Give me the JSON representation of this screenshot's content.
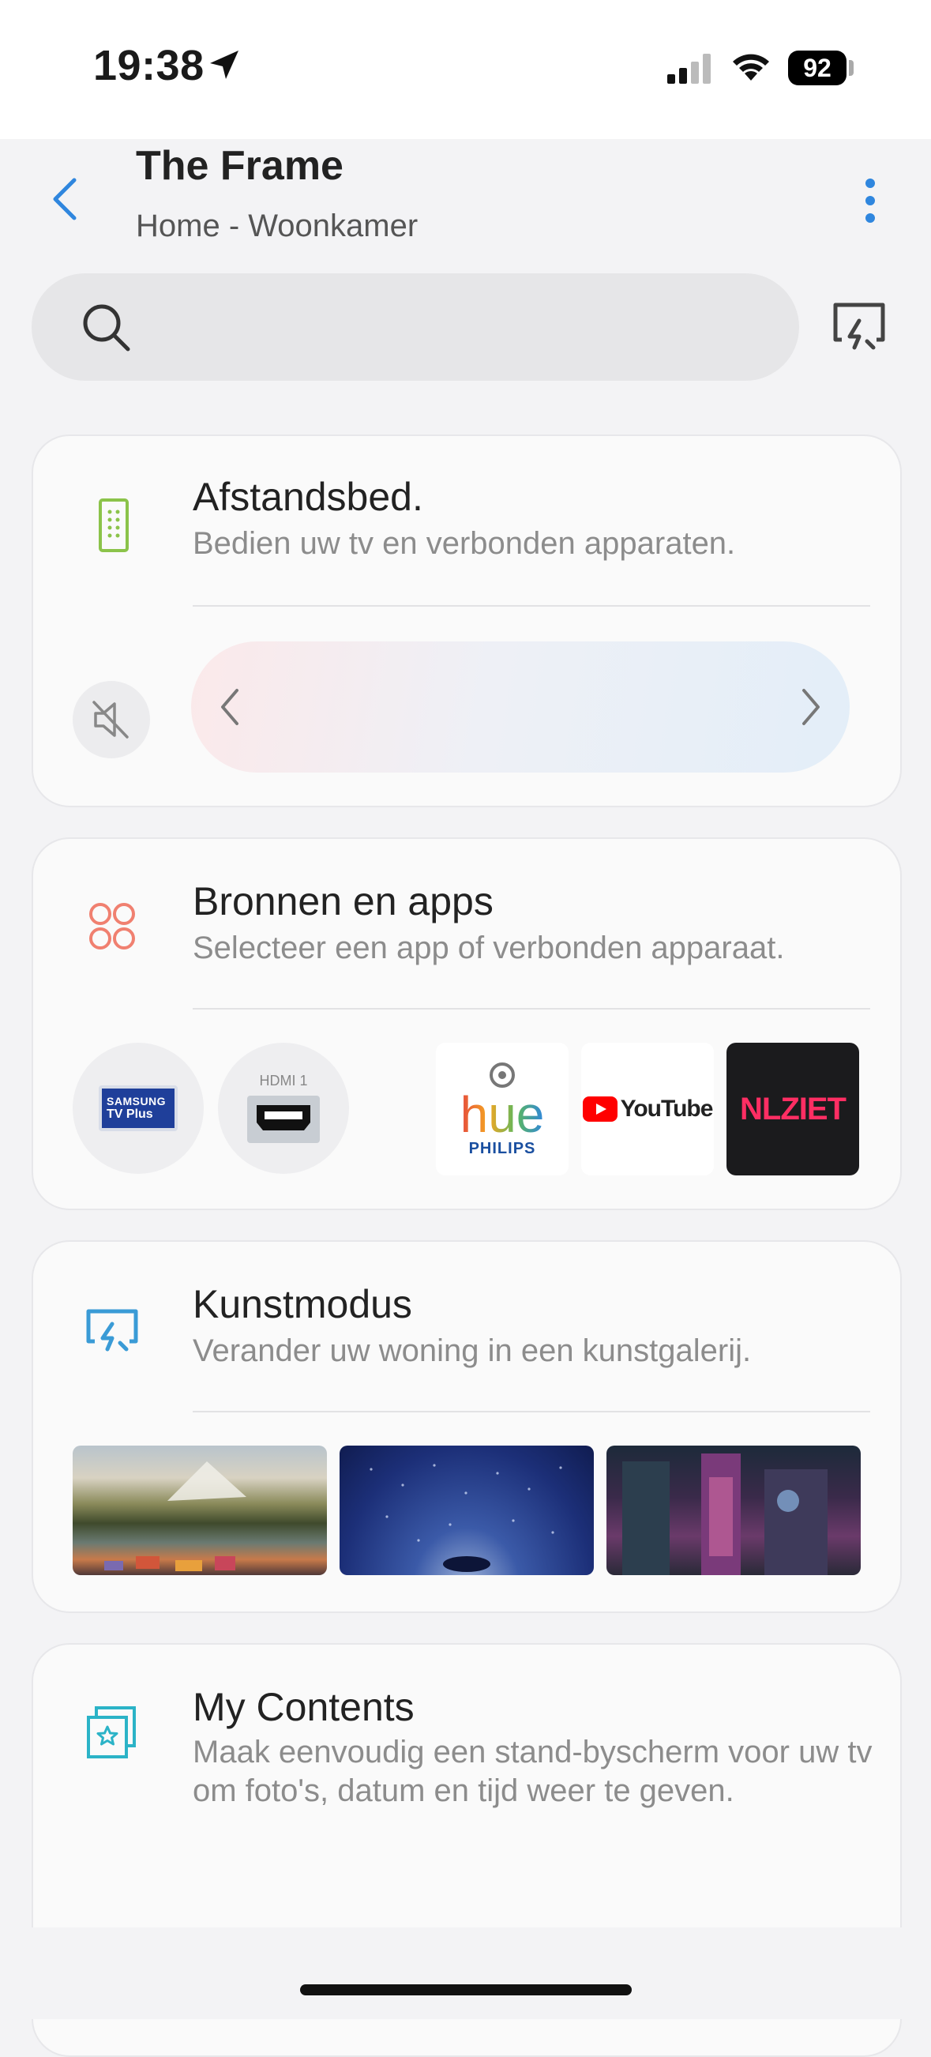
{
  "status": {
    "time": "19:38",
    "battery": "92"
  },
  "header": {
    "title": "The Frame",
    "subtitle": "Home - Woonkamer"
  },
  "search": {
    "placeholder": ""
  },
  "cards": {
    "remote": {
      "title": "Afstandsbed.",
      "description": "Bedien uw tv en verbonden apparaten."
    },
    "sources": {
      "title": "Bronnen en apps",
      "description": "Selecteer een app of verbonden apparaat.",
      "items": {
        "samsung_tv_plus_line1": "SAMSUNG",
        "samsung_tv_plus_line2": "TV Plus",
        "hdmi": "HDMI 1",
        "hue": "hue",
        "hue_brand": "PHILIPS",
        "youtube": "YouTube",
        "nlziet": "NLZIET"
      }
    },
    "art": {
      "title": "Kunstmodus",
      "description": "Verander uw woning in een kunstgalerij."
    },
    "contents": {
      "title": "My Contents",
      "description": "Maak eenvoudig een stand-byscherm voor uw tv om foto's, datum en tijd weer te geven."
    }
  },
  "colors": {
    "accent": "#2f86de",
    "remote_icon": "#8bc34a",
    "sources_icon": "#f08070",
    "art_icon": "#3a9bd6",
    "contents_icon": "#2bb3c7"
  }
}
